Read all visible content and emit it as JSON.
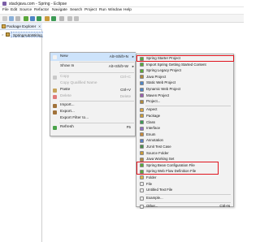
{
  "window": {
    "title": "stackjava.com - Spring - Eclipse"
  },
  "menubar": [
    "File",
    "Edit",
    "Source",
    "Refactor",
    "Navigate",
    "Search",
    "Project",
    "Run",
    "Window",
    "Help"
  ],
  "package_explorer": {
    "tab_label": "Package Explorer",
    "close_glyph": "✕",
    "project_label": "SpringAutoWiring",
    "expand_glyph": ">"
  },
  "context_menu": {
    "submenu_arrow": "▸",
    "items": [
      {
        "label": "New",
        "shortcut": "Alt+Shift+N",
        "has_submenu": true,
        "disabled": false,
        "icon_color": "#f2f2f2"
      },
      {
        "label": "Show In",
        "shortcut": "Alt+Shift+W",
        "has_submenu": true,
        "disabled": false,
        "icon_color": "#f2f2f2"
      },
      {
        "label": "Copy",
        "shortcut": "Ctrl+C",
        "has_submenu": false,
        "disabled": true,
        "icon_color": "#c9c9c9"
      },
      {
        "label": "Copy Qualified Name",
        "shortcut": "",
        "has_submenu": false,
        "disabled": true,
        "icon_color": "#f2f2f2"
      },
      {
        "label": "Paste",
        "shortcut": "Ctrl+V",
        "has_submenu": false,
        "disabled": false,
        "icon_color": "#c7a35a"
      },
      {
        "label": "Delete",
        "shortcut": "Delete",
        "has_submenu": false,
        "disabled": true,
        "icon_color": "#e07a7a"
      },
      {
        "label": "Import...",
        "shortcut": "",
        "has_submenu": false,
        "disabled": false,
        "icon_color": "#a0723a"
      },
      {
        "label": "Export...",
        "shortcut": "",
        "has_submenu": false,
        "disabled": false,
        "icon_color": "#a0723a"
      },
      {
        "label": "Export Filter to...",
        "shortcut": "",
        "has_submenu": false,
        "disabled": false,
        "icon_color": "#f2f2f2"
      },
      {
        "label": "Refresh",
        "shortcut": "F5",
        "has_submenu": false,
        "disabled": false,
        "icon_color": "#4aa34a"
      }
    ]
  },
  "new_submenu": {
    "items": [
      {
        "label": "Spring Starter Project",
        "shortcut": "",
        "icon_color": "#5aa83a",
        "highlighted": true
      },
      {
        "label": "Import Spring Getting Started Content",
        "shortcut": "",
        "icon_color": "#5aa83a",
        "highlighted": false
      },
      {
        "label": "Spring Legacy Project",
        "shortcut": "",
        "icon_color": "#5aa83a",
        "highlighted": false
      },
      {
        "label": "Java Project",
        "shortcut": "",
        "icon_color": "#b08a3e",
        "highlighted": false
      },
      {
        "label": "Static Web Project",
        "shortcut": "",
        "icon_color": "#4f86c6",
        "highlighted": false
      },
      {
        "label": "Dynamic Web Project",
        "shortcut": "",
        "icon_color": "#4f86c6",
        "highlighted": false
      },
      {
        "label": "Maven Project",
        "shortcut": "",
        "icon_color": "#9b5fb0",
        "highlighted": false
      },
      {
        "label": "Project...",
        "shortcut": "",
        "icon_color": "#b08a3e",
        "highlighted": false
      },
      {
        "label": "Aspect",
        "shortcut": "",
        "icon_color": "#d9a441",
        "highlighted": false
      },
      {
        "label": "Package",
        "shortcut": "",
        "icon_color": "#c99b3b",
        "highlighted": false
      },
      {
        "label": "Class",
        "shortcut": "",
        "icon_color": "#3c9b55",
        "highlighted": false
      },
      {
        "label": "Interface",
        "shortcut": "",
        "icon_color": "#8e6fc0",
        "highlighted": false
      },
      {
        "label": "Enum",
        "shortcut": "",
        "icon_color": "#c98a3b",
        "highlighted": false
      },
      {
        "label": "Annotation",
        "shortcut": "",
        "icon_color": "#5a7fc2",
        "highlighted": false
      },
      {
        "label": "JUnit Test Case",
        "shortcut": "",
        "icon_color": "#4c8f4c",
        "highlighted": false
      },
      {
        "label": "Source Folder",
        "shortcut": "",
        "icon_color": "#c99b3b",
        "highlighted": false
      },
      {
        "label": "Java Working Set",
        "shortcut": "",
        "icon_color": "#b08a3e",
        "highlighted": false
      },
      {
        "label": "Spring Bean Configuration File",
        "shortcut": "",
        "icon_color": "#5aa83a",
        "highlighted": true
      },
      {
        "label": "Spring Web Flow Definition File",
        "shortcut": "",
        "icon_color": "#5aa83a",
        "highlighted": true
      },
      {
        "label": "Folder",
        "shortcut": "",
        "icon_color": "#d9b24a",
        "highlighted": false
      },
      {
        "label": "File",
        "shortcut": "",
        "icon_color": "#e8e8e8",
        "highlighted": false
      },
      {
        "label": "Untitled Text File",
        "shortcut": "",
        "icon_color": "#e8e8e8",
        "highlighted": false
      },
      {
        "label": "Example...",
        "shortcut": "",
        "icon_color": "#e8e8e8",
        "highlighted": false
      },
      {
        "label": "Other...",
        "shortcut": "Ctrl+N",
        "icon_color": "#e8e8e8",
        "highlighted": false
      }
    ]
  },
  "colors": {
    "highlight_border": "#e0141e",
    "hover_background": "#cde3fb",
    "menu_background": "#f2f2f2"
  }
}
